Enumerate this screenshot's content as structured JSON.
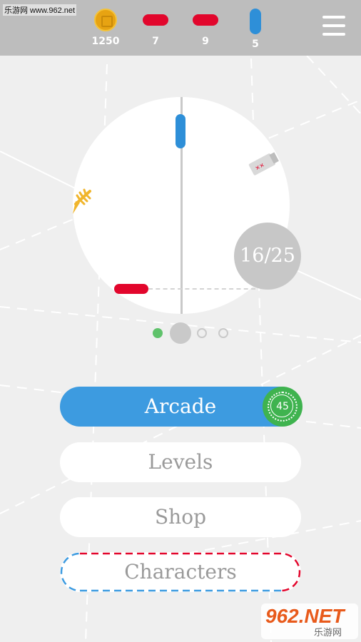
{
  "watermark": {
    "top_text": "乐游网 www.962.net",
    "brand": "962.NET",
    "brand_sub": "乐游网"
  },
  "stats": {
    "coins": "1250",
    "red_item_a": "7",
    "red_item_b": "9",
    "blue_item": "5"
  },
  "game": {
    "progress": "16/25",
    "page_dots_count": 4,
    "page_dots_active_index": 1
  },
  "menu": {
    "arcade": "Arcade",
    "arcade_badge": "45",
    "levels": "Levels",
    "shop": "Shop",
    "characters": "Characters"
  },
  "colors": {
    "accent_blue": "#3d9be0",
    "paddle_red": "#e2062c",
    "badge_green": "#3fb34f",
    "coin_gold": "#e7a312"
  },
  "icons": [
    "coin-icon",
    "red-paddle-icon",
    "blue-paddle-icon",
    "menu-icon",
    "fish-bone-icon",
    "milk-carton-icon"
  ]
}
